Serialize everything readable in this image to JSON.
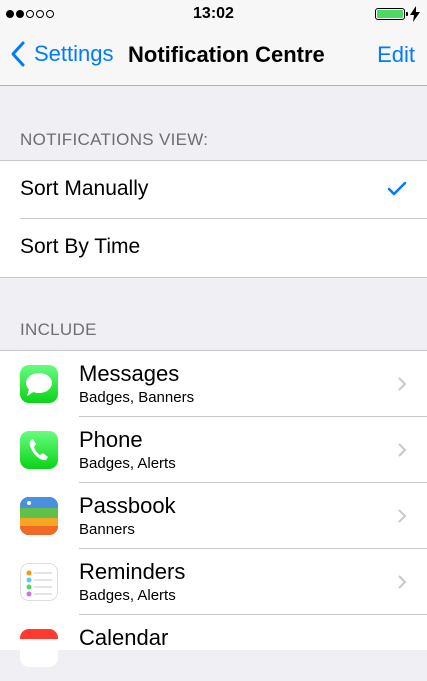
{
  "status": {
    "time": "13:02"
  },
  "nav": {
    "back_label": "Settings",
    "title": "Notification Centre",
    "edit_label": "Edit"
  },
  "view_section": {
    "header": "NOTIFICATIONS VIEW:",
    "options": [
      {
        "label": "Sort Manually",
        "selected": true
      },
      {
        "label": "Sort By Time",
        "selected": false
      }
    ]
  },
  "include_section": {
    "header": "INCLUDE",
    "apps": [
      {
        "name": "Messages",
        "subtitle": "Badges, Banners",
        "icon": "messages-icon"
      },
      {
        "name": "Phone",
        "subtitle": "Badges, Alerts",
        "icon": "phone-icon"
      },
      {
        "name": "Passbook",
        "subtitle": "Banners",
        "icon": "passbook-icon"
      },
      {
        "name": "Reminders",
        "subtitle": "Badges, Alerts",
        "icon": "reminders-icon"
      },
      {
        "name": "Calendar",
        "subtitle": "",
        "icon": "calendar-icon"
      }
    ]
  },
  "colors": {
    "accent": "#007aff",
    "battery": "#4cd964"
  }
}
